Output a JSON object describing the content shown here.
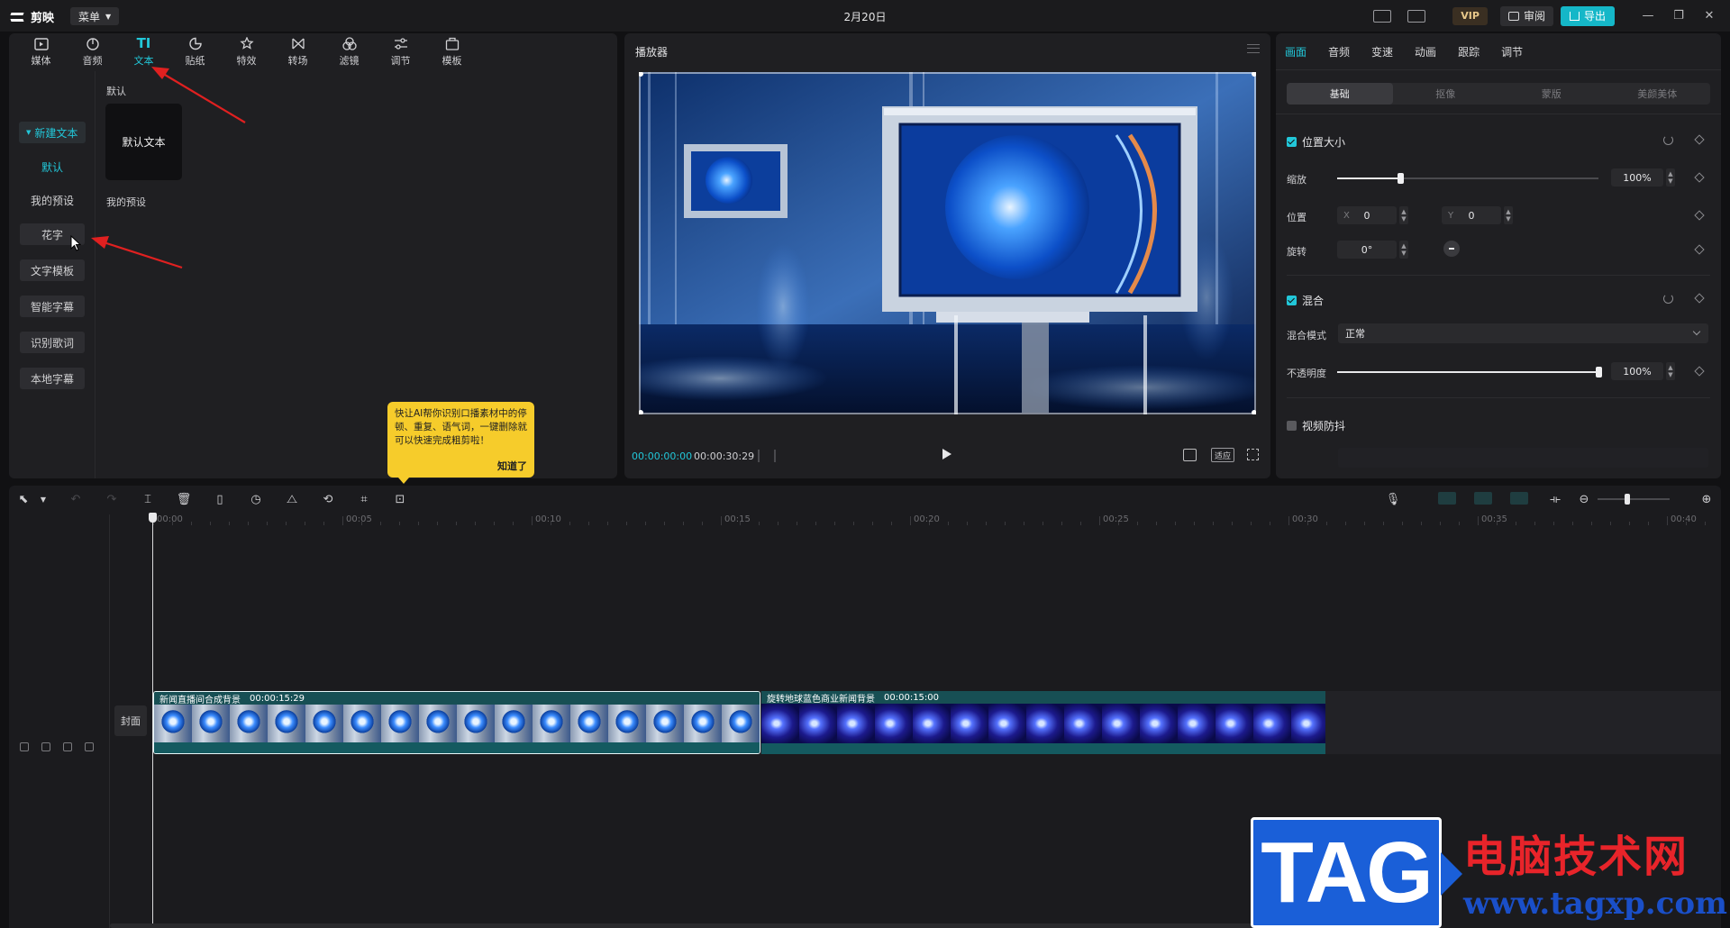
{
  "app": {
    "name": "剪映",
    "menu_label": "菜单",
    "date": "2月20日",
    "vip_label": "VIP",
    "review_label": "审阅",
    "export_label": "导出",
    "colors": {
      "accent": "#22c7d9",
      "tooltip": "#f6cc2b",
      "arrow": "#e02020"
    }
  },
  "tool_tabs": [
    {
      "label": "媒体",
      "icon": "media-icon"
    },
    {
      "label": "音频",
      "icon": "audio-icon"
    },
    {
      "label": "文本",
      "icon": "text-icon",
      "active": true
    },
    {
      "label": "贴纸",
      "icon": "sticker-icon"
    },
    {
      "label": "特效",
      "icon": "effects-icon"
    },
    {
      "label": "转场",
      "icon": "transition-icon"
    },
    {
      "label": "滤镜",
      "icon": "filter-icon"
    },
    {
      "label": "调节",
      "icon": "adjust-icon"
    },
    {
      "label": "模板",
      "icon": "template-icon"
    }
  ],
  "left_nav": {
    "new_text": "新建文本",
    "default": "默认",
    "my_presets": "我的预设",
    "fancy_text": "花字",
    "text_template": "文字模板",
    "smart_caption": "智能字幕",
    "lyrics": "识别歌词",
    "local_caption": "本地字幕"
  },
  "content": {
    "section_default": "默认",
    "default_text_card": "默认文本",
    "section_my_presets": "我的预设"
  },
  "tooltip": {
    "text": "快让AI帮你识别口播素材中的停顿、重复、语气词，一键删除就可以快速完成粗剪啦！",
    "ok": "知道了"
  },
  "player": {
    "title": "播放器",
    "current_time": "00:00:00:00",
    "total_time": "00:00:30:29",
    "ratio_label": "适应"
  },
  "props": {
    "tabs": [
      "画面",
      "音频",
      "变速",
      "动画",
      "跟踪",
      "调节"
    ],
    "seg": [
      "基础",
      "抠像",
      "蒙版",
      "美颜美体"
    ],
    "position_size": "位置大小",
    "scale_label": "缩放",
    "scale_value": "100%",
    "scale_fraction": 0.24,
    "position_label": "位置",
    "pos_x_axis": "X",
    "pos_x": "0",
    "pos_y_axis": "Y",
    "pos_y": "0",
    "rotate_label": "旋转",
    "rotate_value": "0°",
    "blend": "混合",
    "blend_mode_label": "混合模式",
    "blend_mode_value": "正常",
    "opacity_label": "不透明度",
    "opacity_value": "100%",
    "opacity_fraction": 1.0,
    "stabilize": "视频防抖"
  },
  "timeline": {
    "ticks": [
      "00:00",
      "00:05",
      "00:10",
      "00:15",
      "00:20",
      "00:25",
      "00:30",
      "00:35",
      "00:40"
    ],
    "cover_label": "封面",
    "clips": [
      {
        "name": "新闻直播间合成背景",
        "duration": "00:00:15:29"
      },
      {
        "name": "旋转地球蓝色商业新闻背景",
        "duration": "00:00:15:00"
      }
    ]
  },
  "watermark": {
    "tag": "TAG",
    "title": "电脑技术网",
    "url": "www.tagxp.com"
  }
}
